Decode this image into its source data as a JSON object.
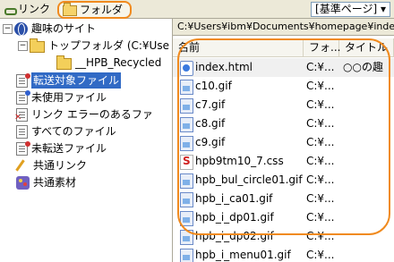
{
  "toolbar": {
    "link_label": "リンク",
    "folder_label": "フォルダ",
    "view_select": "[基準ページ]",
    "view_select_arrow": "▾"
  },
  "tree": {
    "root": "趣味のサイト",
    "top_folder": "トップフォルダ (C:¥Use",
    "sub_folder": "__HPB_Recycled",
    "items": [
      "転送対象ファイル",
      "未使用ファイル",
      "リンク エラーのあるファ",
      "すべてのファイル",
      "未転送ファイル",
      "共通リンク",
      "共通素材"
    ]
  },
  "list": {
    "path": "C:¥Users¥ibm¥Documents¥homepage¥index.html",
    "columns": [
      "名前",
      "フォ...",
      "タイトル"
    ],
    "rows": [
      {
        "name": "index.html",
        "folder": "C:¥...",
        "title": "○○の趣",
        "type": "html"
      },
      {
        "name": "c10.gif",
        "folder": "C:¥...",
        "title": "",
        "type": "gif"
      },
      {
        "name": "c7.gif",
        "folder": "C:¥...",
        "title": "",
        "type": "gif"
      },
      {
        "name": "c8.gif",
        "folder": "C:¥...",
        "title": "",
        "type": "gif"
      },
      {
        "name": "c9.gif",
        "folder": "C:¥...",
        "title": "",
        "type": "gif"
      },
      {
        "name": "hpb9tm10_7.css",
        "folder": "C:¥...",
        "title": "",
        "type": "css"
      },
      {
        "name": "hpb_bul_circle01.gif",
        "folder": "C:¥...",
        "title": "",
        "type": "gif"
      },
      {
        "name": "hpb_i_ca01.gif",
        "folder": "C:¥...",
        "title": "",
        "type": "gif"
      },
      {
        "name": "hpb_i_dp01.gif",
        "folder": "C:¥...",
        "title": "",
        "type": "gif"
      },
      {
        "name": "hpb_i_dp02.gif",
        "folder": "C:¥...",
        "title": "",
        "type": "gif"
      },
      {
        "name": "hpb_i_menu01.gif",
        "folder": "C:¥...",
        "title": "",
        "type": "gif"
      }
    ]
  },
  "colors": {
    "highlight_outline": "#f08a1e",
    "selection": "#316ac5"
  }
}
